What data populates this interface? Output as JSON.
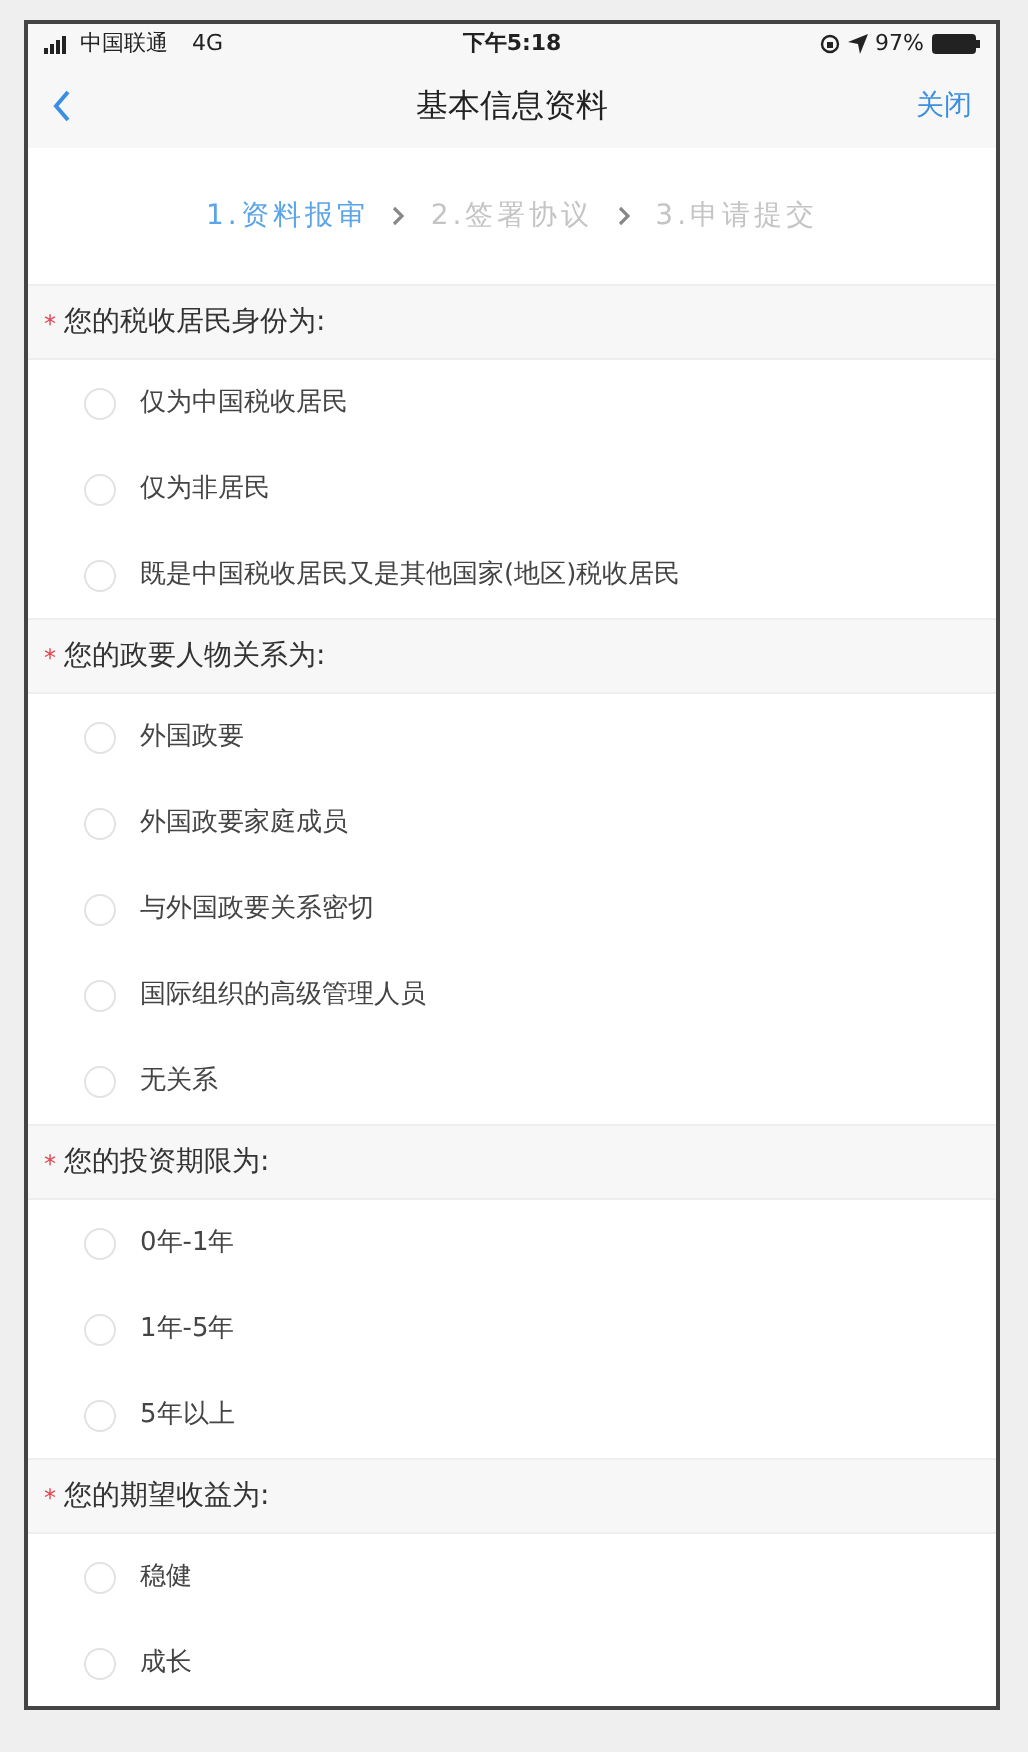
{
  "status_bar": {
    "carrier": "中国联通",
    "network": "4G",
    "time": "下午5:18",
    "battery": "97%"
  },
  "nav_bar": {
    "title": "基本信息资料",
    "close": "关闭"
  },
  "steps": [
    {
      "label": "1.资料报审",
      "selected": true
    },
    {
      "label": "2.签署协议",
      "selected": false
    },
    {
      "label": "3.申请提交",
      "selected": false
    }
  ],
  "questions": [
    {
      "title": "您的税收居民身份为:",
      "required_mark": "*",
      "options": [
        {
          "label": "仅为中国税收居民",
          "selected": false
        },
        {
          "label": "仅为非居民",
          "selected": false
        },
        {
          "label": "既是中国税收居民又是其他国家(地区)税收居民",
          "selected": false
        }
      ]
    },
    {
      "title": "您的政要人物关系为:",
      "required_mark": "*",
      "options": [
        {
          "label": "外国政要",
          "selected": false
        },
        {
          "label": "外国政要家庭成员",
          "selected": false
        },
        {
          "label": "与外国政要关系密切",
          "selected": false
        },
        {
          "label": "国际组织的高级管理人员",
          "selected": false
        },
        {
          "label": "无关系",
          "selected": false
        }
      ]
    },
    {
      "title": "您的投资期限为:",
      "required_mark": "*",
      "options": [
        {
          "label": "0年-1年",
          "selected": false
        },
        {
          "label": "1年-5年",
          "selected": false
        },
        {
          "label": "5年以上",
          "selected": false
        }
      ]
    },
    {
      "title": "您的期望收益为:",
      "required_mark": "*",
      "options": [
        {
          "label": "稳健",
          "selected": false
        },
        {
          "label": "成长",
          "selected": false
        }
      ]
    }
  ]
}
